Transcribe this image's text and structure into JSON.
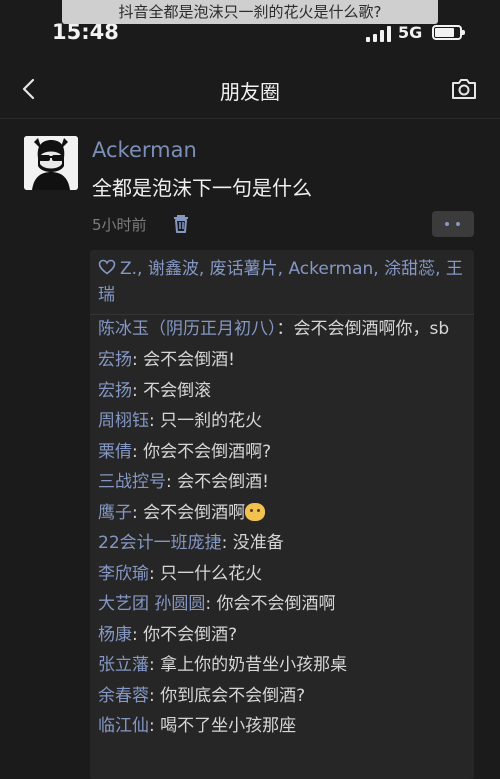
{
  "overlay_title": "抖音全都是泡沫只一刹的花火是什么歌?",
  "status": {
    "time": "15:48",
    "network": "5G",
    "battery_level": 0.8
  },
  "nav": {
    "title": "朋友圈",
    "back_icon": "chevron-left-icon",
    "camera_icon": "camera-icon"
  },
  "post": {
    "author": "Ackerman",
    "text": "全都是泡沫下一句是什么",
    "time": "5小时前",
    "delete_icon": "trash-icon",
    "more_icon": "more-dots-icon"
  },
  "likes": {
    "icon": "heart-icon",
    "names": "Z.,  谢鑫波,  废话薯片,  Ackerman,  涂甜蕊,  王瑞"
  },
  "comments": [
    {
      "name": "陈冰玉（阴历正月初八）",
      "text": "：会不会倒酒啊你，sb"
    },
    {
      "name": "宏扬",
      "text": ": 会不会倒酒!"
    },
    {
      "name": "宏扬",
      "text": ": 不会倒滚"
    },
    {
      "name": "周栩钰",
      "text": ": 只一刹的花火"
    },
    {
      "name": "栗倩",
      "text": ": 你会不会倒酒啊?"
    },
    {
      "name": "三战控号",
      "text": ": 会不会倒酒!"
    },
    {
      "name": "鹰子",
      "text": ": 会不会倒酒啊"
    },
    {
      "name": "22会计一班庞捷",
      "text": ": 没准备"
    },
    {
      "name": "李欣瑜",
      "text": ": 只一什么花火"
    },
    {
      "name": "大艺团 孙圆圆",
      "text": ": 你会不会倒酒啊"
    },
    {
      "name": "杨康",
      "text": ": 你不会倒酒?"
    },
    {
      "name": "张立藩",
      "text": ": 拿上你的奶昔坐小孩那桌"
    },
    {
      "name": "余春蓉",
      "text": ": 你到底会不会倒酒?"
    },
    {
      "name": "临江仙",
      "text": ": 喝不了坐小孩那座"
    }
  ]
}
